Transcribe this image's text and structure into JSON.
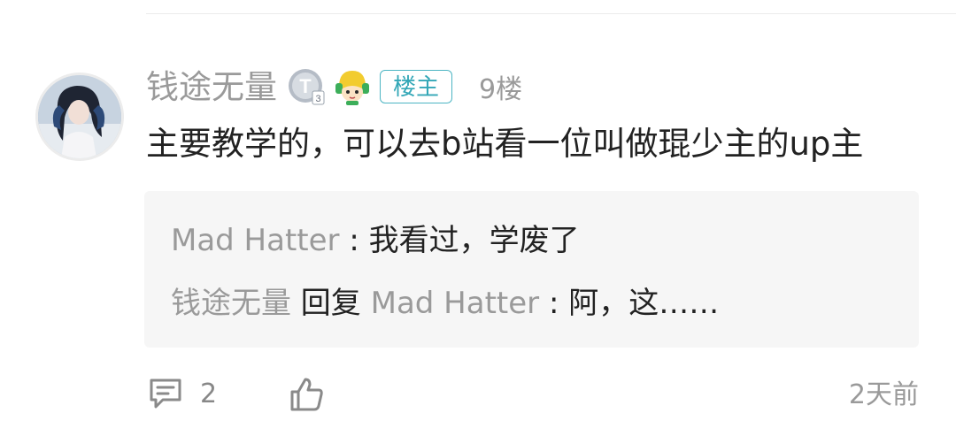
{
  "comment": {
    "username": "钱途无量",
    "level_badge_letter": "T",
    "level_badge_number": "3",
    "op_tag": "楼主",
    "floor": "9楼",
    "content": "主要教学的，可以去b站看一位叫做琨少主的up主",
    "time": "2天前",
    "comment_count": "2"
  },
  "replies": [
    {
      "name": "Mad Hatter",
      "separator": " : ",
      "text": "我看过，学废了"
    },
    {
      "name": "钱途无量",
      "reply_word": " 回复 ",
      "target": "Mad Hatter",
      "separator": " : ",
      "text": "阿，这……"
    }
  ],
  "colors": {
    "name_gray": "#9a9a9a",
    "text_dark": "#222222",
    "op_tag_teal": "#33a7b7",
    "reply_bg": "#f6f6f6"
  },
  "icons": [
    "comment-icon",
    "thumbs-up-icon",
    "level-badge-icon",
    "mascot-badge-icon"
  ]
}
